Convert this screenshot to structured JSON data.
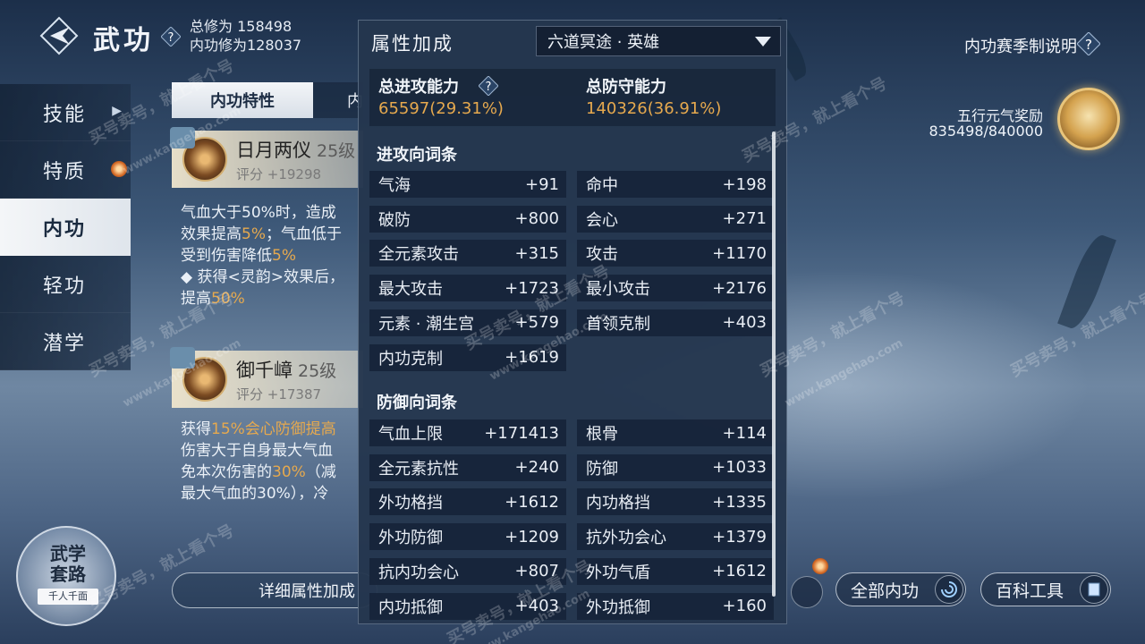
{
  "header": {
    "title": "武功",
    "total_cultivation": "总修为 158498",
    "inner_cultivation": "内功修为128037",
    "season_rules": "内功赛季制说明"
  },
  "reward": {
    "label": "五行元气奖励",
    "count": "835498/840000"
  },
  "nav": {
    "items": [
      {
        "label": "技能"
      },
      {
        "label": "特质"
      },
      {
        "label": "内功"
      },
      {
        "label": "轻功"
      },
      {
        "label": "潜学"
      }
    ]
  },
  "tabs": {
    "active": "内功特性",
    "second": "内"
  },
  "skills": [
    {
      "name": "日月两仪",
      "level": "25级",
      "score": "评分 +19298",
      "desc": [
        [
          "气血大于50%时，造成",
          ""
        ],
        [
          "效果提高",
          "5%",
          "；气血低于"
        ],
        [
          "受到伤害降低",
          "5%",
          ""
        ],
        [
          "◆ 获得<灵韵>效果后，",
          "",
          ""
        ],
        [
          "提高",
          "50%",
          ""
        ]
      ]
    },
    {
      "name": "御千嶂",
      "level": "25级",
      "score": "评分 +17387",
      "desc": [
        [
          "获得",
          "15%会心防御提高",
          ""
        ],
        [
          "伤害大于自身最大气血",
          "",
          ""
        ],
        [
          "免本次伤害的",
          "30%",
          "（减"
        ],
        [
          "最大气血的30%），冷",
          "",
          ""
        ]
      ]
    }
  ],
  "detail_button": "详细属性加成",
  "wuxue": {
    "title": "武学套路",
    "tag": "千人千面"
  },
  "bottom_buttons": {
    "all_inner": "全部内功",
    "wiki": "百科工具"
  },
  "panel": {
    "title": "属性加成",
    "dropdown": "六道冥途 · 英雄",
    "total_attack_label": "总进攻能力",
    "total_attack_value": "65597(29.31%)",
    "total_defense_label": "总防守能力",
    "total_defense_value": "140326(36.91%)",
    "attack_section": "进攻向词条",
    "attack_stats": [
      {
        "name": "气海",
        "value": "+91"
      },
      {
        "name": "命中",
        "value": "+198"
      },
      {
        "name": "破防",
        "value": "+800"
      },
      {
        "name": "会心",
        "value": "+271"
      },
      {
        "name": "全元素攻击",
        "value": "+315"
      },
      {
        "name": "攻击",
        "value": "+1170"
      },
      {
        "name": "最大攻击",
        "value": "+1723"
      },
      {
        "name": "最小攻击",
        "value": "+2176"
      },
      {
        "name": "元素 · 潮生宫",
        "value": "+579"
      },
      {
        "name": "首领克制",
        "value": "+403"
      },
      {
        "name": "内功克制",
        "value": "+1619"
      }
    ],
    "defense_section": "防御向词条",
    "defense_stats": [
      {
        "name": "气血上限",
        "value": "+171413"
      },
      {
        "name": "根骨",
        "value": "+114"
      },
      {
        "name": "全元素抗性",
        "value": "+240"
      },
      {
        "name": "防御",
        "value": "+1033"
      },
      {
        "name": "外功格挡",
        "value": "+1612"
      },
      {
        "name": "内功格挡",
        "value": "+1335"
      },
      {
        "name": "外功防御",
        "value": "+1209"
      },
      {
        "name": "抗外功会心",
        "value": "+1379"
      },
      {
        "name": "抗内功会心",
        "value": "+807"
      },
      {
        "name": "外功气盾",
        "value": "+1612"
      },
      {
        "name": "内功抵御",
        "value": "+403"
      },
      {
        "name": "外功抵御",
        "value": "+160"
      }
    ]
  },
  "watermark": {
    "text1": "买号卖号，就上看个号",
    "text2": "www.kangehao.com"
  },
  "colors": {
    "gold": "#e6a94e",
    "panel": "#24364e"
  }
}
